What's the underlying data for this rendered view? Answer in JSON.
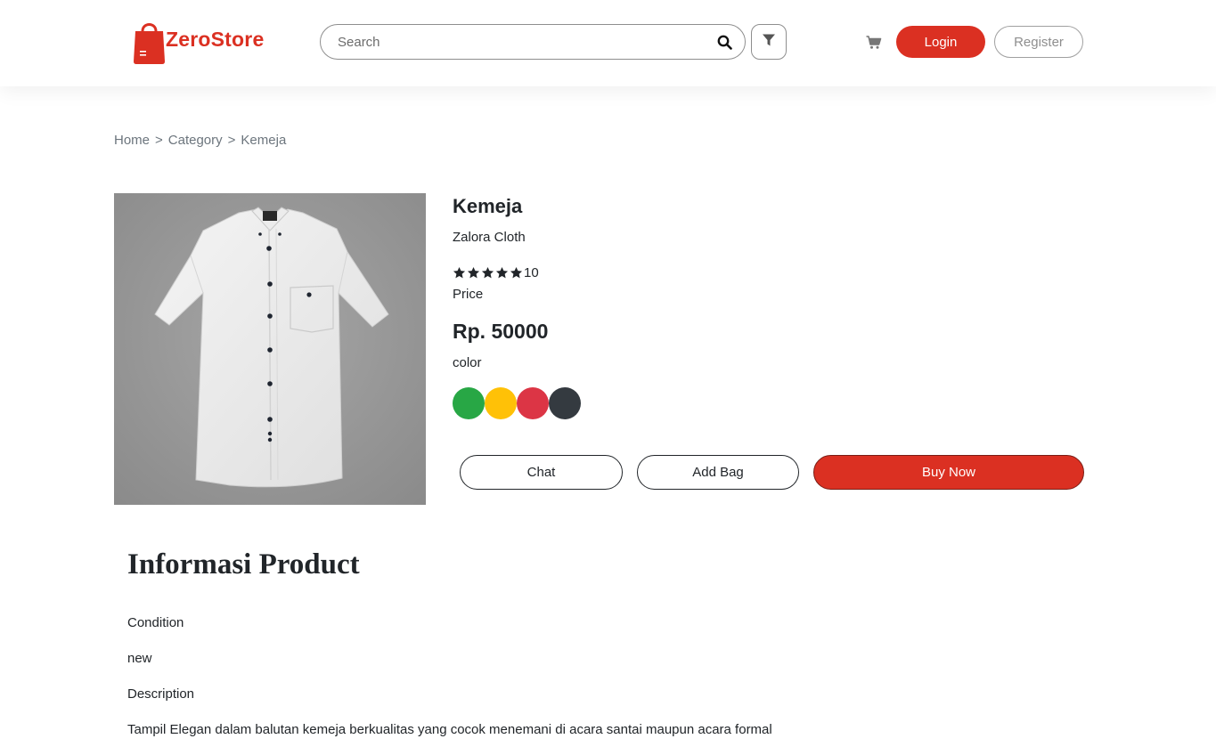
{
  "header": {
    "logo_text": "ZeroStore",
    "search_placeholder": "Search",
    "login_label": "Login",
    "register_label": "Register",
    "icons": {
      "search": "search-icon",
      "filter": "filter-icon",
      "cart": "cart-icon"
    }
  },
  "breadcrumb": {
    "items": [
      "Home",
      "Category",
      "Kemeja"
    ],
    "separator": ">"
  },
  "product": {
    "title": "Kemeja",
    "brand": "Zalora Cloth",
    "rating_stars": 5,
    "rating_count": "10",
    "price_label": "Price",
    "price": "Rp. 50000",
    "color_label": "color",
    "colors": [
      "#28a745",
      "#ffc107",
      "#dc3545",
      "#343a40"
    ]
  },
  "actions": {
    "chat_label": "Chat",
    "add_bag_label": "Add Bag",
    "buy_now_label": "Buy Now"
  },
  "info": {
    "heading": "Informasi Product",
    "condition_label": "Condition",
    "condition_value": "new",
    "description_label": "Description",
    "description_value": "Tampil Elegan dalam balutan kemeja berkualitas yang cocok menemani di acara santai maupun acara formal"
  },
  "theme": {
    "accent": "#db3022",
    "text": "#212529",
    "muted": "#6c757d"
  }
}
